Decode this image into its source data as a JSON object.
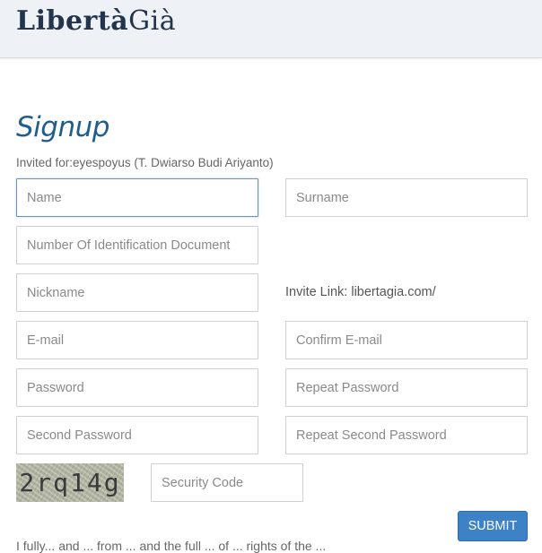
{
  "header": {
    "logo_part1": "Libertà",
    "logo_part2": "Già"
  },
  "form": {
    "title": "Signup",
    "invited_for": "Invited for:eyespoyus (T. Dwiarso Budi Ariyanto)",
    "fields": {
      "name": "Name",
      "surname": "Surname",
      "id_document": "Number Of Identification Document",
      "nickname": "Nickname",
      "email": "E-mail",
      "confirm_email": "Confirm E-mail",
      "password": "Password",
      "repeat_password": "Repeat Password",
      "second_password": "Second Password",
      "repeat_second_password": "Repeat Second Password",
      "security_code": "Security Code"
    },
    "invite_link": "Invite Link: libertagia.com/",
    "captcha_text": "2rq14g",
    "submit_label": "SUBMIT",
    "footer_partial": "I fully... and ... from ... and the full ... of ... rights of the ..."
  }
}
